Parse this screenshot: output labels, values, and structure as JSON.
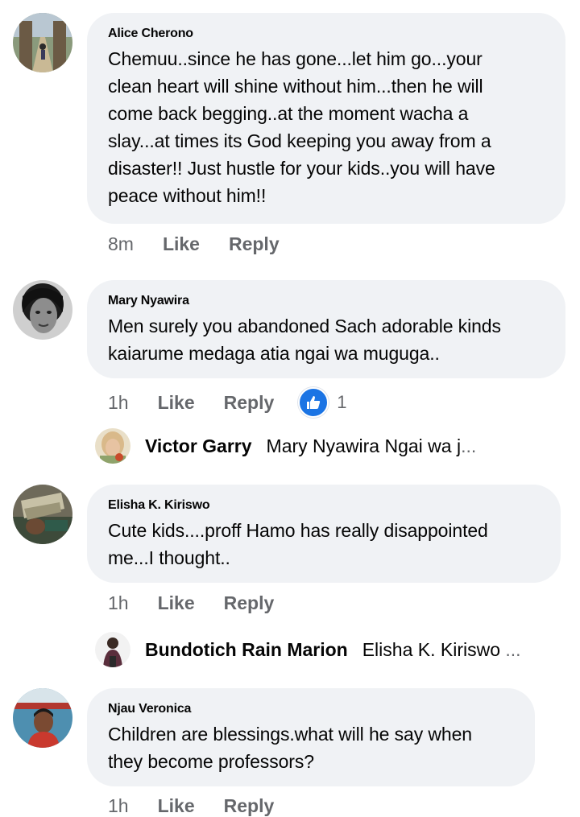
{
  "comments": [
    {
      "author": "Alice Cherono",
      "text": "Chemuu..since he has gone...let him go...your\nclean heart will shine without him...then he will\ncome back begging..at the moment wacha a\nslay...at times its God keeping you away from a\ndisaster!! Just hustle for your kids..you will have\npeace without him!!",
      "time": "8m",
      "like": "Like",
      "reply": "Reply"
    },
    {
      "author": "Mary Nyawira",
      "text": "Men surely you abandoned Sach adorable kinds\nkaiarume medaga atia ngai wa muguga..",
      "time": "1h",
      "like": "Like",
      "reply": "Reply",
      "reaction_count": "1"
    },
    {
      "author": "Elisha K. Kiriswo",
      "text": "Cute kids....proff Hamo has really disappointed\nme...I thought..",
      "time": "1h",
      "like": "Like",
      "reply": "Reply"
    },
    {
      "author": "Njau Veronica",
      "text": "Children are blessings.what will he say when\nthey become professors?",
      "time": "1h",
      "like": "Like",
      "reply": "Reply"
    }
  ],
  "replies": [
    {
      "author": "Victor Garry",
      "text": "Mary Nyawira Ngai wa j",
      "ellipsis": "..."
    },
    {
      "author": "Bundotich Rain Marion",
      "text": "Elisha K. Kiriswo ",
      "ellipsis": "..."
    }
  ],
  "colors": {
    "bubble": "#f0f2f5",
    "meta": "#65676b",
    "like_blue": "#1b74e4"
  }
}
